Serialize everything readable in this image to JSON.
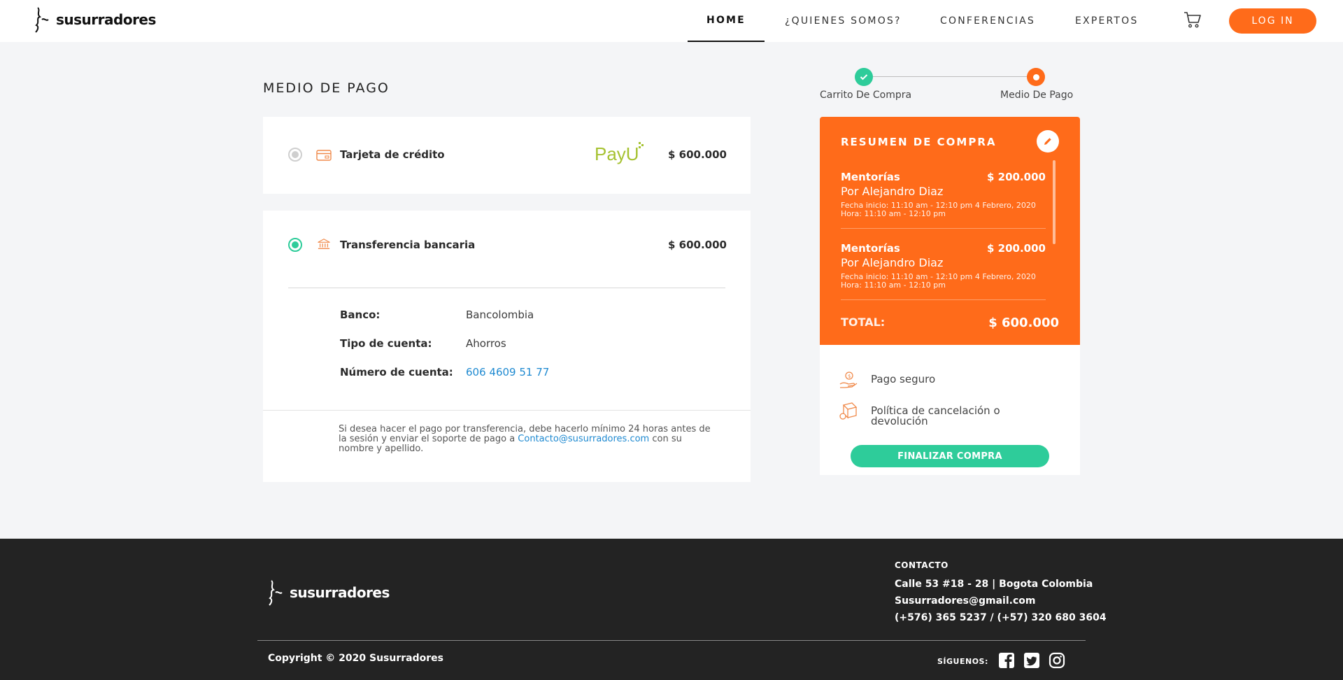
{
  "header": {
    "logo_text": "susurradores",
    "nav": [
      {
        "label": "HOME"
      },
      {
        "label": "¿QUIENES SOMOS?"
      },
      {
        "label": "CONFERENCIAS"
      },
      {
        "label": "EXPERTOS"
      }
    ],
    "cart_icon": "cart-icon",
    "login_label": "LOG IN"
  },
  "payment": {
    "title": "MEDIO DE PAGO",
    "methods": [
      {
        "label": "Tarjeta de crédito",
        "amount": "$ 600.000",
        "provider": "PayU",
        "selected": false,
        "icon": "credit-card-icon"
      },
      {
        "label": "Transferencia bancaria",
        "amount": "$ 600.000",
        "selected": true,
        "icon": "bank-icon"
      }
    ],
    "bank": {
      "bank_label": "Banco:",
      "bank_value": "Bancolombia",
      "type_label": "Tipo de cuenta:",
      "type_value": "Ahorros",
      "number_label": "Número de cuenta:",
      "number_value": "606 4609 51 77"
    },
    "note_pre": "Si desea hacer el pago por transferencia, debe hacerlo mínimo 24 horas antes de la sesión y enviar el soporte de pago a ",
    "note_email": "Contacto@susurradores.com",
    "note_post": " con su nombre y apellido."
  },
  "stepper": {
    "steps": [
      {
        "label": "Carrito De Compra",
        "state": "done"
      },
      {
        "label": "Medio De Pago",
        "state": "active"
      }
    ]
  },
  "summary": {
    "title": "RESUMEN DE COMPRA",
    "items": [
      {
        "name": "Mentorías",
        "price": "$ 200.000",
        "expert": "Por Alejandro Diaz",
        "date": "Fecha inicio: 11:10 am - 12:10 pm 4 Febrero, 2020",
        "hour": "Hora: 11:10 am - 12:10 pm"
      },
      {
        "name": "Mentorías",
        "price": "$ 200.000",
        "expert": "Por Alejandro Diaz",
        "date": "Fecha inicio: 11:10 am - 12:10 pm 4 Febrero, 2020",
        "hour": "Hora: 11:10 am - 12:10 pm"
      }
    ],
    "total_label": "TOTAL:",
    "total_value": "$ 600.000",
    "secure_label": "Pago seguro",
    "policy_label_1": "Política de cancelación o",
    "policy_label_2": "devolución",
    "finalize_label": "FINALIZAR COMPRA"
  },
  "footer": {
    "logo_text": "susurradores",
    "contact_title": "CONTACTO",
    "address": "Calle 53 #18 - 28 | Bogota Colombia",
    "email": "Susurradores@gmail.com",
    "phones": "(+576) 365 5237 / (+57) 320 680 3604",
    "copyright": "Copyright © 2020 Susurradores",
    "follow_label": "SÍGUENOS:",
    "social": [
      "facebook-icon",
      "twitter-icon",
      "instagram-icon"
    ]
  },
  "colors": {
    "accent": "#ff6b1a",
    "success": "#2ecc9a",
    "link": "#1f8ad1",
    "footer_bg": "#232323",
    "page_bg": "#f4f5f7"
  }
}
